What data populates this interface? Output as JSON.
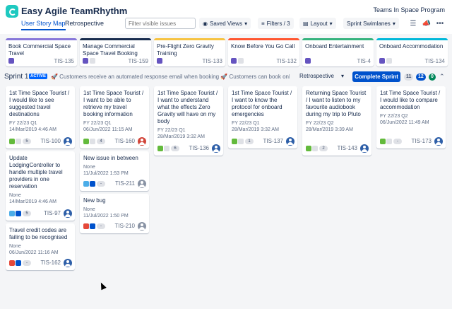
{
  "app": {
    "title": "Easy Agile TeamRhythm",
    "project": "Teams In Space Program"
  },
  "tabs": [
    {
      "label": "User Story Map"
    },
    {
      "label": "Retrospective"
    }
  ],
  "toolbar": {
    "filter_placeholder": "Filter visible issues",
    "saved_views": "Saved Views",
    "filters": "Filters / 3",
    "layout": "Layout",
    "swimlanes": "Sprint Swimlanes"
  },
  "epics": [
    {
      "title": "Book Commercial Space Travel",
      "key": "TIS-135",
      "color": "#8777d9"
    },
    {
      "title": "Manage Commercial Space Travel Booking",
      "key": "TIS-159",
      "color": "#172b4d"
    },
    {
      "title": "Pre-Flight Zero Gravity Training",
      "key": "TIS-133",
      "color": "#f6c342"
    },
    {
      "title": "Know Before You Go Call",
      "key": "TIS-132",
      "color": "#ff5630"
    },
    {
      "title": "Onboard Entertainment",
      "key": "TIS-4",
      "color": "#36b37e"
    },
    {
      "title": "Onboard Accommodation",
      "key": "TIS-134",
      "color": "#00b8d9"
    }
  ],
  "sprint": {
    "name": "Sprint 1",
    "badge": "ACTIVE",
    "goal": "🚀 Customers receive an automated response email when booking 🚀 Customers can book onb...",
    "retro": "Retrospective",
    "complete": "Complete Sprint",
    "counts": [
      "11",
      "12",
      "0"
    ]
  },
  "cards": [
    {
      "title": "1st Time Space Tourist / I would like to see suggested travel destinations",
      "version": "FY 22/23 Q1",
      "date": "14/Mar/2019 4:46 AM",
      "key": "TIS-100",
      "est": "5",
      "type": "story"
    },
    {
      "title": "Update LodgingController to handle multiple travel providers in one reservation",
      "version": "None",
      "date": "14/Mar/2019 4:46 AM",
      "key": "TIS-97",
      "est": "5",
      "type": "task"
    },
    {
      "title": "Travel credit codes are failing to be recognised",
      "version": "None",
      "date": "06/Jun/2022 11:16 AM",
      "key": "TIS-162",
      "est": "-",
      "type": "bug"
    },
    {
      "title": "1st Time Space Tourist / I want to be able to retrieve my travel booking information",
      "version": "FY 22/23 Q1",
      "date": "06/Jun/2022 11:15 AM",
      "key": "TIS-160",
      "est": "4",
      "type": "story"
    },
    {
      "title": "New issue in between",
      "version": "None",
      "date": "11/Jul/2022 1:53 PM",
      "key": "TIS-211",
      "est": "-",
      "type": "task"
    },
    {
      "title": "New bug",
      "version": "None",
      "date": "11/Jul/2022 1:50 PM",
      "key": "TIS-210",
      "est": "-",
      "type": "bug"
    },
    {
      "title": "1st Time Space Tourist / I want to understand what the effects Zero Gravity will have on my body",
      "version": "FY 22/23 Q1",
      "date": "28/Mar/2019 3:32 AM",
      "key": "TIS-136",
      "est": "6",
      "type": "story"
    },
    {
      "title": "1st Time Space Tourist / I want to know the protocol for onboard emergencies",
      "version": "FY 22/23 Q1",
      "date": "28/Mar/2019 3:32 AM",
      "key": "TIS-137",
      "est": "1",
      "type": "story"
    },
    {
      "title": "Returning Space Tourist / I want to listen to my favourite audiobook during my trip to Pluto",
      "version": "FY 22/23 Q2",
      "date": "28/Mar/2019 3:39 AM",
      "key": "TIS-143",
      "est": "2",
      "type": "story"
    },
    {
      "title": "1st Time Space Tourist / I would like to compare accommodation",
      "version": "FY 22/23 Q2",
      "date": "06/Jun/2022 11:49 AM",
      "key": "TIS-173",
      "est": "-",
      "type": "story"
    }
  ]
}
